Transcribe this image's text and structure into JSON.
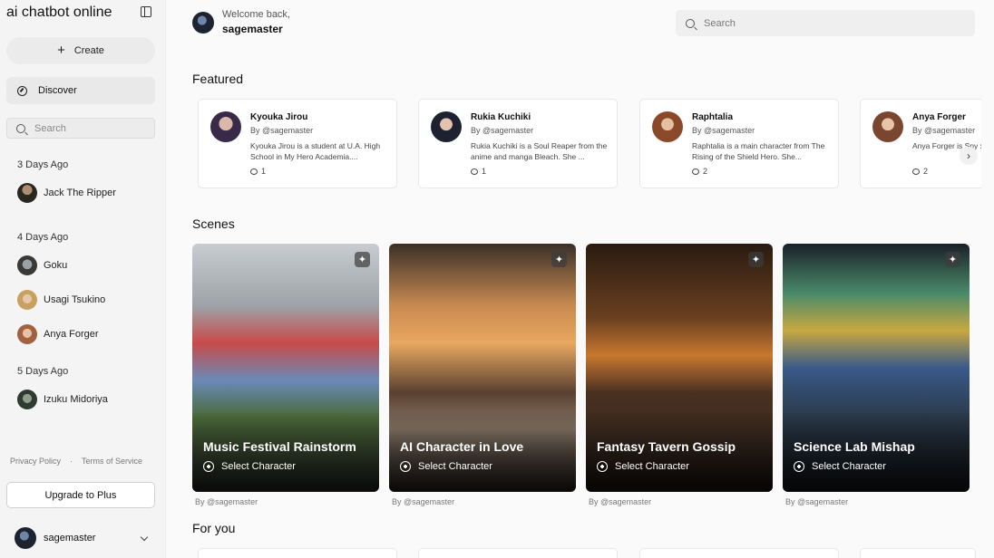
{
  "sidebar": {
    "brand": "ai chatbot online",
    "create_label": "Create",
    "discover_label": "Discover",
    "search_placeholder": "Search",
    "history": [
      {
        "label": "3 Days Ago",
        "items": [
          "Jack The Ripper"
        ]
      },
      {
        "label": "4 Days Ago",
        "items": [
          "Goku",
          "Usagi Tsukino",
          "Anya Forger"
        ]
      },
      {
        "label": "5 Days Ago",
        "items": [
          "Izuku Midoriya"
        ]
      }
    ],
    "privacy": "Privacy Policy",
    "separator": "·",
    "terms": "Terms of Service",
    "upgrade_label": "Upgrade to Plus",
    "username": "sagemaster"
  },
  "header": {
    "welcome": "Welcome back,",
    "username": "sagemaster",
    "search_placeholder": "Search"
  },
  "sections": {
    "featured": "Featured",
    "scenes": "Scenes",
    "for_you": "For you"
  },
  "featured": [
    {
      "name": "Kyouka Jirou",
      "by": "By @sagemaster",
      "desc": "Kyouka Jirou is a student at U.A. High School in My Hero Academia....",
      "count": "1"
    },
    {
      "name": "Rukia Kuchiki",
      "by": "By @sagemaster",
      "desc": "Rukia Kuchiki is a Soul Reaper from the anime and manga Bleach. She ...",
      "count": "1"
    },
    {
      "name": "Raphtalia",
      "by": "By @sagemaster",
      "desc": "Raphtalia is a main character from The Rising of the Shield Hero. She...",
      "count": "2"
    },
    {
      "name": "Anya Forger",
      "by": "By @sagemaster",
      "desc": "Anya Forger is Spy x Family",
      "count": "2"
    }
  ],
  "scenes": [
    {
      "title": "Music Festival Rainstorm",
      "select": "Select Character",
      "by": "By @sagemaster"
    },
    {
      "title": "AI Character in Love",
      "select": "Select Character",
      "by": "By @sagemaster"
    },
    {
      "title": "Fantasy Tavern Gossip",
      "select": "Select Character",
      "by": "By @sagemaster"
    },
    {
      "title": "Science Lab Mishap",
      "select": "Select Character",
      "by": "By @sagemaster"
    }
  ],
  "icons": {
    "next_arrow": "chevron-right-icon",
    "sparkle": "sparkle-icon"
  }
}
